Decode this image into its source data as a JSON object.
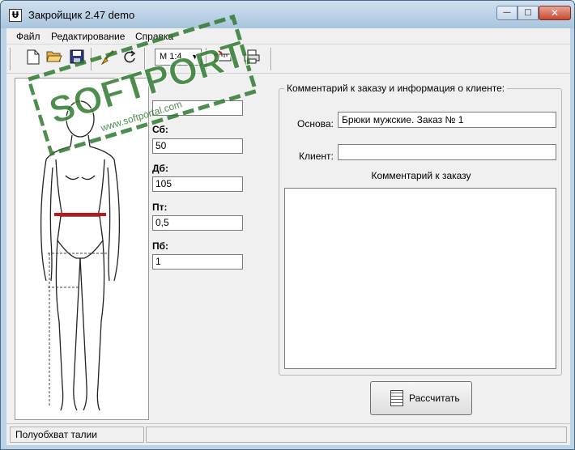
{
  "window": {
    "title": "Закройщик 2.47 demo",
    "app_icon_glyph": "Ʉ",
    "controls": {
      "minimize": "—",
      "maximize": "□",
      "close": "✕"
    }
  },
  "menu": {
    "items": [
      {
        "label": "Файл"
      },
      {
        "label": "Редактирование"
      },
      {
        "label": "Справка"
      }
    ]
  },
  "toolbar": {
    "icons": [
      "new-file-icon",
      "open-folder-icon",
      "save-icon",
      "brush-icon",
      "refresh-icon",
      "ruler-icon",
      "print-icon"
    ],
    "scale_value": "М 1:4"
  },
  "parameters": [
    {
      "label": "",
      "value": ""
    },
    {
      "label": "Сб:",
      "value": "50"
    },
    {
      "label": "Дб:",
      "value": "105"
    },
    {
      "label": "Пт:",
      "value": "0,5"
    },
    {
      "label": "Пб:",
      "value": "1"
    }
  ],
  "client_info": {
    "caption": "Комментарий к заказу и информация о клиенте:",
    "base_label": "Основа:",
    "base_value": "Брюки мужские. Заказ № 1",
    "client_label": "Клиент:",
    "client_value": "",
    "comment_heading": "Комментарий к заказу",
    "comment_value": ""
  },
  "actions": {
    "calculate_label": "Рассчитать"
  },
  "status": {
    "text": "Полуобхват талии",
    "secondary": ""
  },
  "watermark": {
    "text_main": "SOFTPORTAL",
    "text_url": "www.softportal.com",
    "color": "#2f7a2f"
  },
  "colors": {
    "waist_marker": "#c0141a",
    "close_button": "#c84a30"
  }
}
